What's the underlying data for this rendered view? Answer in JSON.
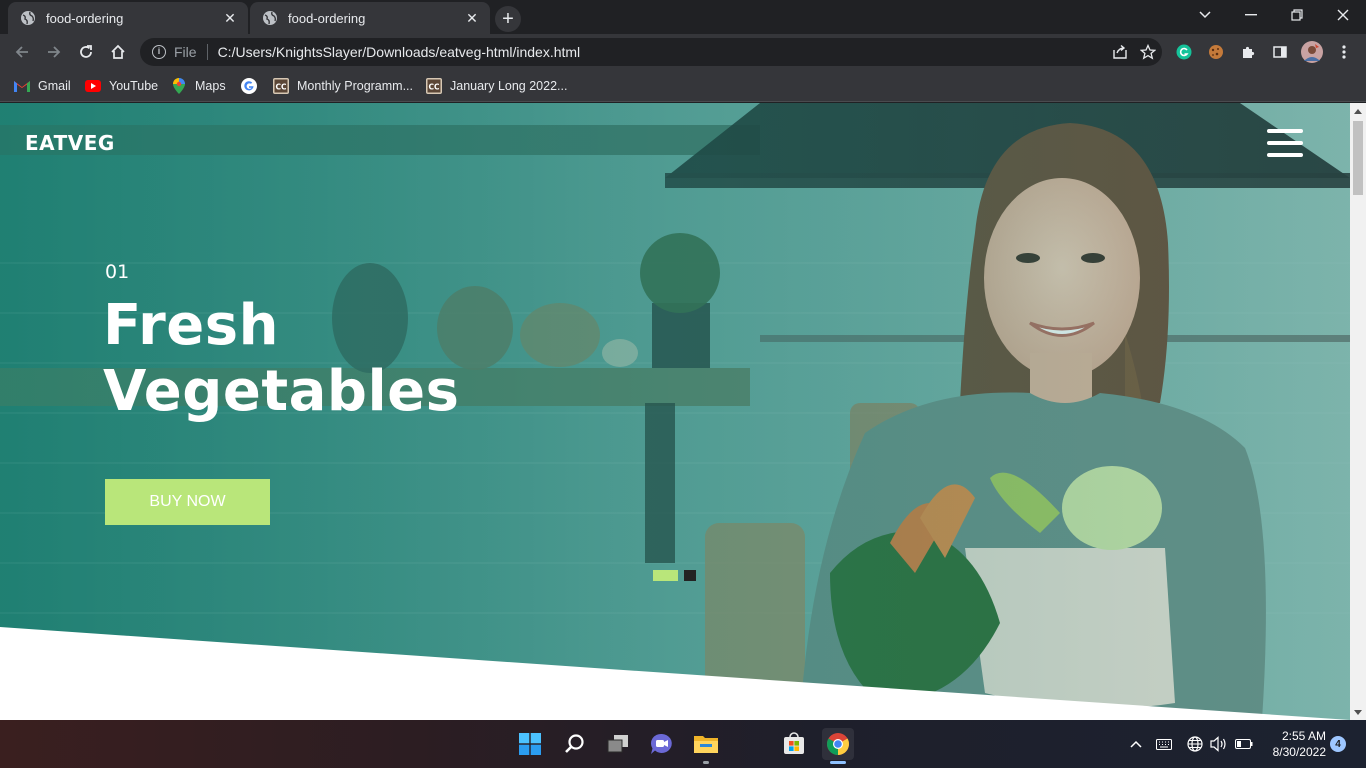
{
  "browser": {
    "tabs": [
      {
        "title": "food-ordering",
        "active": false
      },
      {
        "title": "food-ordering",
        "active": true
      }
    ],
    "scheme_label": "File",
    "url": "C:/Users/KnightsSlayer/Downloads/eatveg-html/index.html",
    "bookmarks": [
      {
        "label": "Gmail",
        "icon": "gmail-icon"
      },
      {
        "label": "YouTube",
        "icon": "youtube-icon"
      },
      {
        "label": "Maps",
        "icon": "maps-icon"
      },
      {
        "label": "",
        "icon": "google-icon"
      },
      {
        "label": "Monthly Programm...",
        "icon": "codechef-icon"
      },
      {
        "label": "January Long 2022...",
        "icon": "codechef-icon"
      }
    ],
    "colors": {
      "frame": "#202124",
      "toolbar": "#35363a",
      "text": "#e8eaed"
    }
  },
  "site": {
    "logo": "EATVEG",
    "slide_number": "01",
    "headline_line1": "Fresh",
    "headline_line2": "Vegetables",
    "cta_label": "BUY NOW",
    "slides_total": 2,
    "slide_active": 1,
    "colors": {
      "accent": "#b9e67a",
      "overlay": "#1f8a7e",
      "dot_inactive": "#232323"
    }
  },
  "taskbar": {
    "time": "2:55 AM",
    "date": "8/30/2022",
    "notification_count": "4",
    "apps": [
      "start-icon",
      "search-icon",
      "task-view-icon",
      "chat-icon",
      "file-explorer-icon",
      "microsoft-store-icon",
      "chrome-icon"
    ]
  }
}
